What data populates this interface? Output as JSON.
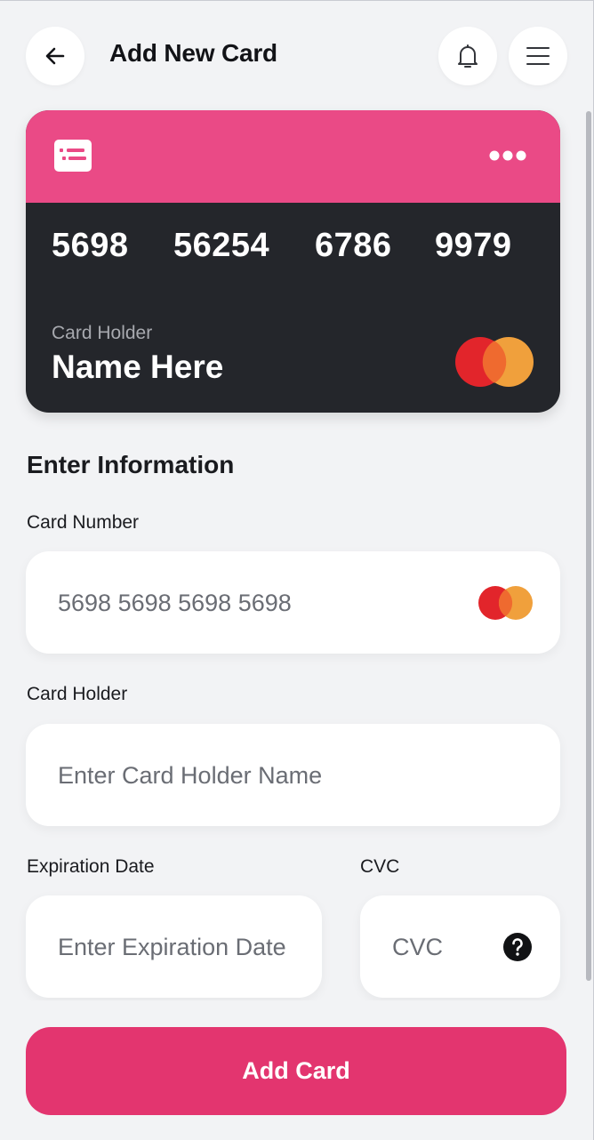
{
  "header": {
    "title": "Add New Card",
    "back_icon": "arrow-left-icon",
    "bell_icon": "bell-icon",
    "menu_icon": "hamburger-menu-icon"
  },
  "card_preview": {
    "number_groups": [
      "5698",
      "56254",
      "6786",
      "9979"
    ],
    "holder_label": "Card Holder",
    "holder_name": "Name Here",
    "top_color": "#ea4a86",
    "body_color": "#24262b",
    "brand_icon": "mastercard-logo"
  },
  "form": {
    "section_title": "Enter Information",
    "card_number": {
      "label": "Card Number",
      "placeholder": "5698 5698 5698 5698"
    },
    "card_holder": {
      "label": "Card Holder",
      "placeholder": "Enter Card Holder Name"
    },
    "expiration": {
      "label": "Expiration Date",
      "placeholder": "Enter Expiration Date"
    },
    "cvc": {
      "label": "CVC",
      "placeholder": "CVC",
      "help_icon": "question-mark-icon"
    }
  },
  "actions": {
    "add_card_label": "Add Card",
    "accent": "#e3356f"
  }
}
